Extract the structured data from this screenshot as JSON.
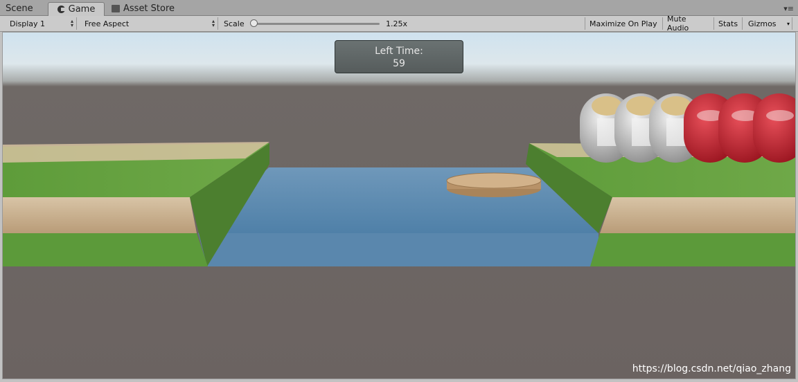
{
  "tabs": {
    "scene": "Scene",
    "game": "Game",
    "asset_store": "Asset Store"
  },
  "toolbar": {
    "display": "Display 1",
    "aspect": "Free Aspect",
    "scale_label": "Scale",
    "scale_value": "1.25x",
    "maximize": "Maximize On Play",
    "mute": "Mute Audio",
    "stats": "Stats",
    "gizmos": "Gizmos"
  },
  "hud": {
    "timer_label": "Left Time:",
    "timer_value": "59"
  },
  "watermark": "https://blog.csdn.net/qiao_zhang",
  "colors": {
    "sky": "#d6e6ef",
    "ground": "#6b6361",
    "water": "#5f8fb5",
    "grass": "#5f9a3a",
    "soil": "#c9ad88",
    "boat": "#c19a6b",
    "priest": "#d7d7d7",
    "devil": "#c0202a"
  }
}
